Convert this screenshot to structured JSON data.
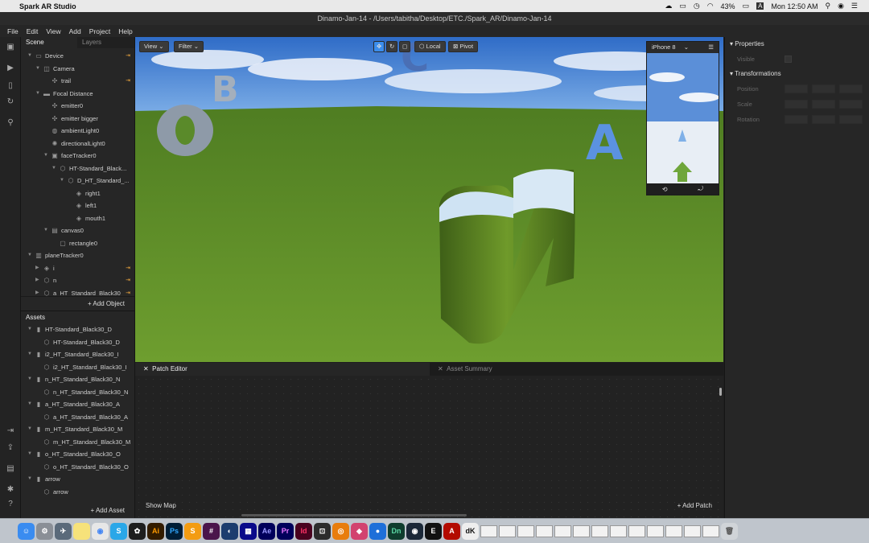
{
  "menubar": {
    "app_name": "Spark AR Studio",
    "battery": "43%",
    "clock": "Mon 12:50 AM",
    "input_indicator": "A"
  },
  "window": {
    "title": "Dinamo-Jan-14 - /Users/tabitha/Desktop/ETC./Spark_AR/Dinamo-Jan-14"
  },
  "app_menu": [
    "File",
    "Edit",
    "View",
    "Add",
    "Project",
    "Help"
  ],
  "scene_panel": {
    "tabs": [
      "Scene",
      "Layers"
    ],
    "tree": [
      {
        "label": "Device",
        "indent": 0,
        "expanded": true,
        "icon": "device-icon",
        "pin": true
      },
      {
        "label": "Camera",
        "indent": 1,
        "expanded": true,
        "icon": "camera-icon",
        "pin": false
      },
      {
        "label": "trail",
        "indent": 2,
        "expanded": null,
        "icon": "emitter-icon",
        "pin": true
      },
      {
        "label": "Focal Distance",
        "indent": 1,
        "expanded": true,
        "icon": "focal-distance-icon",
        "pin": false
      },
      {
        "label": "emitter0",
        "indent": 2,
        "expanded": null,
        "icon": "emitter-icon",
        "pin": false
      },
      {
        "label": "emitter bigger",
        "indent": 2,
        "expanded": null,
        "icon": "emitter-icon",
        "pin": false
      },
      {
        "label": "ambientLight0",
        "indent": 2,
        "expanded": null,
        "icon": "ambient-light-icon",
        "pin": false
      },
      {
        "label": "directionalLight0",
        "indent": 2,
        "expanded": null,
        "icon": "directional-light-icon",
        "pin": false
      },
      {
        "label": "faceTracker0",
        "indent": 2,
        "expanded": true,
        "icon": "face-tracker-icon",
        "pin": false
      },
      {
        "label": "HT-Standard_Black...",
        "indent": 3,
        "expanded": true,
        "icon": "mesh-icon",
        "pin": false
      },
      {
        "label": "D_HT_Standard_...",
        "indent": 4,
        "expanded": true,
        "icon": "mesh-icon",
        "pin": false
      },
      {
        "label": "right1",
        "indent": 5,
        "expanded": null,
        "icon": "null-object-icon",
        "pin": false
      },
      {
        "label": "left1",
        "indent": 5,
        "expanded": null,
        "icon": "null-object-icon",
        "pin": false
      },
      {
        "label": "mouth1",
        "indent": 5,
        "expanded": null,
        "icon": "null-object-icon",
        "pin": false
      },
      {
        "label": "canvas0",
        "indent": 2,
        "expanded": true,
        "icon": "canvas-icon",
        "pin": false
      },
      {
        "label": "rectangle0",
        "indent": 3,
        "expanded": null,
        "icon": "rectangle-icon",
        "pin": false
      },
      {
        "label": "planeTracker0",
        "indent": 0,
        "expanded": true,
        "icon": "plane-tracker-icon",
        "pin": false
      },
      {
        "label": "i",
        "indent": 1,
        "expanded": false,
        "icon": "null-object-icon",
        "pin": true
      },
      {
        "label": "n",
        "indent": 1,
        "expanded": false,
        "icon": "mesh-icon",
        "pin": true
      },
      {
        "label": "a_HT_Standard_Black30",
        "indent": 1,
        "expanded": false,
        "icon": "mesh-icon",
        "pin": true
      }
    ],
    "add_object_label": "+ Add Object"
  },
  "assets_panel": {
    "title": "Assets",
    "items": [
      {
        "label": "HT-Standard_Black30_D",
        "indent": 0,
        "expanded": true,
        "icon": "file-icon"
      },
      {
        "label": "HT-Standard_Black30_D",
        "indent": 1,
        "expanded": null,
        "icon": "mesh-icon"
      },
      {
        "label": "i2_HT_Standard_Black30_I",
        "indent": 0,
        "expanded": true,
        "icon": "file-icon"
      },
      {
        "label": "i2_HT_Standard_Black30_I",
        "indent": 1,
        "expanded": null,
        "icon": "mesh-icon"
      },
      {
        "label": "n_HT_Standard_Black30_N",
        "indent": 0,
        "expanded": true,
        "icon": "file-icon"
      },
      {
        "label": "n_HT_Standard_Black30_N",
        "indent": 1,
        "expanded": null,
        "icon": "mesh-icon"
      },
      {
        "label": "a_HT_Standard_Black30_A",
        "indent": 0,
        "expanded": true,
        "icon": "file-icon"
      },
      {
        "label": "a_HT_Standard_Black30_A",
        "indent": 1,
        "expanded": null,
        "icon": "mesh-icon"
      },
      {
        "label": "m_HT_Standard_Black30_M",
        "indent": 0,
        "expanded": true,
        "icon": "file-icon"
      },
      {
        "label": "m_HT_Standard_Black30_M",
        "indent": 1,
        "expanded": null,
        "icon": "mesh-icon"
      },
      {
        "label": "o_HT_Standard_Black30_O",
        "indent": 0,
        "expanded": true,
        "icon": "file-icon"
      },
      {
        "label": "o_HT_Standard_Black30_O",
        "indent": 1,
        "expanded": null,
        "icon": "mesh-icon"
      },
      {
        "label": "arrow",
        "indent": 0,
        "expanded": true,
        "icon": "file-icon"
      },
      {
        "label": "arrow",
        "indent": 1,
        "expanded": null,
        "icon": "mesh-icon"
      }
    ],
    "add_asset_label": "+ Add Asset"
  },
  "viewport": {
    "view_label": "View",
    "filter_label": "Filter",
    "local_label": "Local",
    "pivot_label": "Pivot",
    "letters": [
      "O",
      "B",
      "C",
      "A",
      "M"
    ]
  },
  "preview": {
    "device": "iPhone 8"
  },
  "properties": {
    "title": "Properties",
    "visible_label": "Visible",
    "transformations_title": "Transformations",
    "rows": [
      "Position",
      "Scale",
      "Rotation"
    ]
  },
  "bottom": {
    "patch_editor_tab": "Patch Editor",
    "asset_summary_tab": "Asset Summary",
    "show_map_label": "Show Map",
    "add_patch_label": "+ Add Patch"
  },
  "colors": {
    "accent": "#3b8ded",
    "pin": "#e8a33d",
    "sky": "#3d7bd1",
    "grass": "#5a8a2a"
  }
}
